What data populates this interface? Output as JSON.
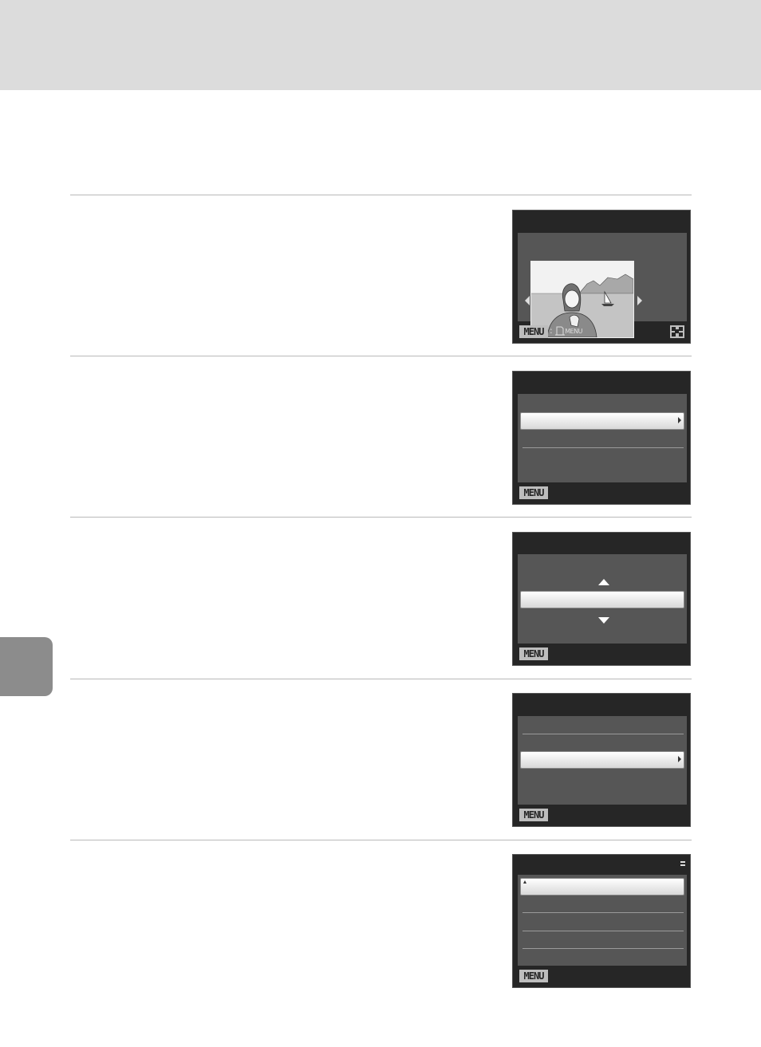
{
  "screens": [
    {
      "menu_label": "MENU",
      "print_label": "MENU"
    },
    {
      "menu_label": "MENU"
    },
    {
      "menu_label": "MENU"
    },
    {
      "menu_label": "MENU"
    },
    {
      "menu_label": "MENU"
    }
  ]
}
